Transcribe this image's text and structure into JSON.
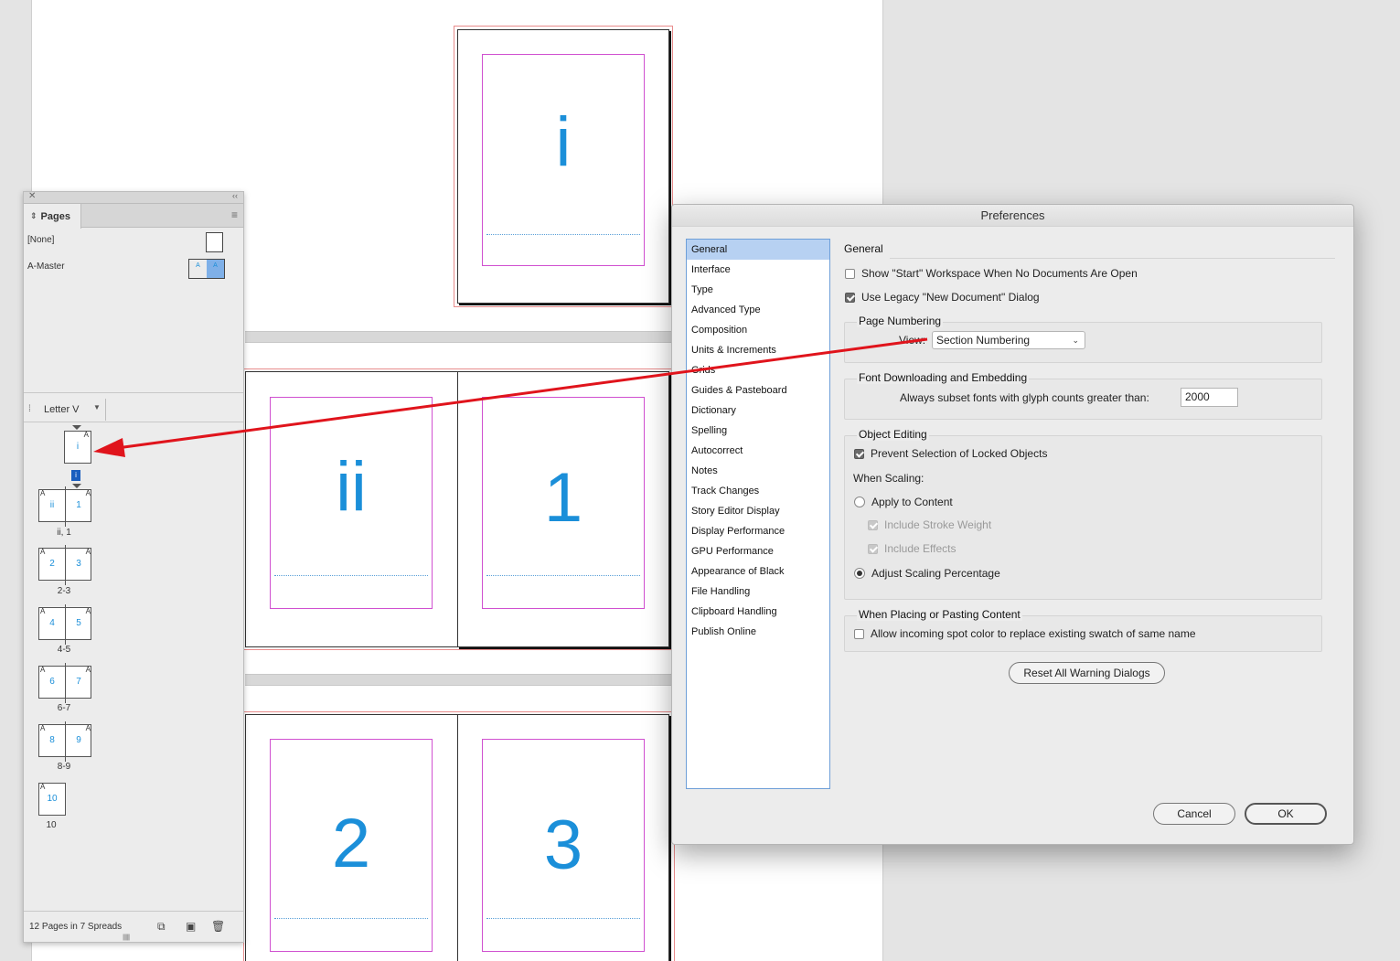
{
  "document": {
    "pages": [
      {
        "label": "i"
      },
      {
        "label": "ii"
      },
      {
        "label": "1"
      },
      {
        "label": "2"
      },
      {
        "label": "3"
      }
    ]
  },
  "pages_panel": {
    "tab_label": "Pages",
    "masters": [
      {
        "label": "[None]"
      },
      {
        "label": "A-Master",
        "prefix": "A"
      }
    ],
    "page_size": "Letter V",
    "selected_page": "i",
    "spreads": [
      {
        "pages": [
          {
            "master": "A",
            "num": "i"
          }
        ],
        "label": ""
      },
      {
        "pages": [
          {
            "master": "A",
            "num": "ii"
          },
          {
            "master": "A",
            "num": "1"
          }
        ],
        "label": "ii, 1"
      },
      {
        "pages": [
          {
            "master": "A",
            "num": "2"
          },
          {
            "master": "A",
            "num": "3"
          }
        ],
        "label": "2-3"
      },
      {
        "pages": [
          {
            "master": "A",
            "num": "4"
          },
          {
            "master": "A",
            "num": "5"
          }
        ],
        "label": "4-5"
      },
      {
        "pages": [
          {
            "master": "A",
            "num": "6"
          },
          {
            "master": "A",
            "num": "7"
          }
        ],
        "label": "6-7"
      },
      {
        "pages": [
          {
            "master": "A",
            "num": "8"
          },
          {
            "master": "A",
            "num": "9"
          }
        ],
        "label": "8-9"
      },
      {
        "pages": [
          {
            "master": "A",
            "num": "10"
          }
        ],
        "label": "10"
      }
    ],
    "footer_count": "12 Pages in 7 Spreads"
  },
  "preferences": {
    "title": "Preferences",
    "categories": [
      "General",
      "Interface",
      "Type",
      "Advanced Type",
      "Composition",
      "Units & Increments",
      "Grids",
      "Guides & Pasteboard",
      "Dictionary",
      "Spelling",
      "Autocorrect",
      "Notes",
      "Track Changes",
      "Story Editor Display",
      "Display Performance",
      "GPU Performance",
      "Appearance of Black",
      "File Handling",
      "Clipboard Handling",
      "Publish Online"
    ],
    "selected_category": "General",
    "section_title": "General",
    "show_start_workspace": {
      "label": "Show \"Start\" Workspace When No Documents Are Open",
      "checked": false
    },
    "use_legacy_dialog": {
      "label": "Use Legacy \"New Document\" Dialog",
      "checked": true
    },
    "page_numbering": {
      "title": "Page Numbering",
      "view_label": "View:",
      "view_value": "Section Numbering"
    },
    "font_downloading": {
      "title": "Font Downloading and Embedding",
      "subset_label": "Always subset fonts with glyph counts greater than:",
      "subset_value": "2000"
    },
    "object_editing": {
      "title": "Object Editing",
      "prevent_selection": {
        "label": "Prevent Selection of Locked Objects",
        "checked": true
      },
      "when_scaling": "When Scaling:",
      "apply_to_content": {
        "label": "Apply to Content",
        "selected": false
      },
      "include_stroke_weight": {
        "label": "Include Stroke Weight",
        "checked": true
      },
      "include_effects": {
        "label": "Include Effects",
        "checked": true
      },
      "adjust_scaling": {
        "label": "Adjust Scaling Percentage",
        "selected": true
      }
    },
    "placing": {
      "title": "When Placing or Pasting Content",
      "allow_spot_color": {
        "label": "Allow incoming spot color to replace existing swatch of same name",
        "checked": false
      }
    },
    "reset_button": "Reset All Warning Dialogs",
    "cancel_button": "Cancel",
    "ok_button": "OK"
  },
  "colors": {
    "page_number": "#1b8fd9",
    "margin_guide": "#d050d0",
    "bleed_guide": "#e88c8c",
    "arrow": "#e0141c",
    "selection": "#b7d1f2"
  }
}
